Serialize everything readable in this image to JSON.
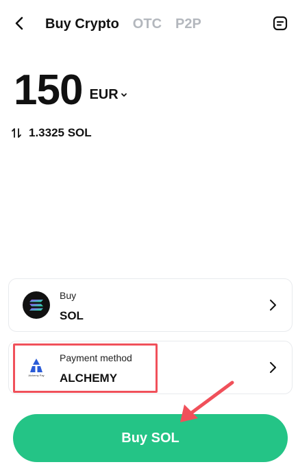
{
  "header": {
    "back_icon": "chevron-left-icon",
    "tabs": [
      {
        "label": "Buy Crypto",
        "active": true
      },
      {
        "label": "OTC",
        "active": false
      },
      {
        "label": "P2P",
        "active": false
      }
    ],
    "orders_icon": "order-list-icon"
  },
  "amount": {
    "value": "150",
    "currency": "EUR"
  },
  "conversion": {
    "text": "1.3325 SOL"
  },
  "buy_card": {
    "label": "Buy",
    "value": "SOL",
    "icon": "solana-logo-icon"
  },
  "payment_card": {
    "label": "Payment method",
    "value": "ALCHEMY",
    "icon": "alchemy-pay-logo-icon",
    "logo_caption": "Alchemy Pay"
  },
  "buy_button": {
    "label": "Buy SOL"
  },
  "colors": {
    "accent_green": "#24c486",
    "highlight_red": "#f0505a",
    "inactive_tab": "#b3b7bd"
  }
}
